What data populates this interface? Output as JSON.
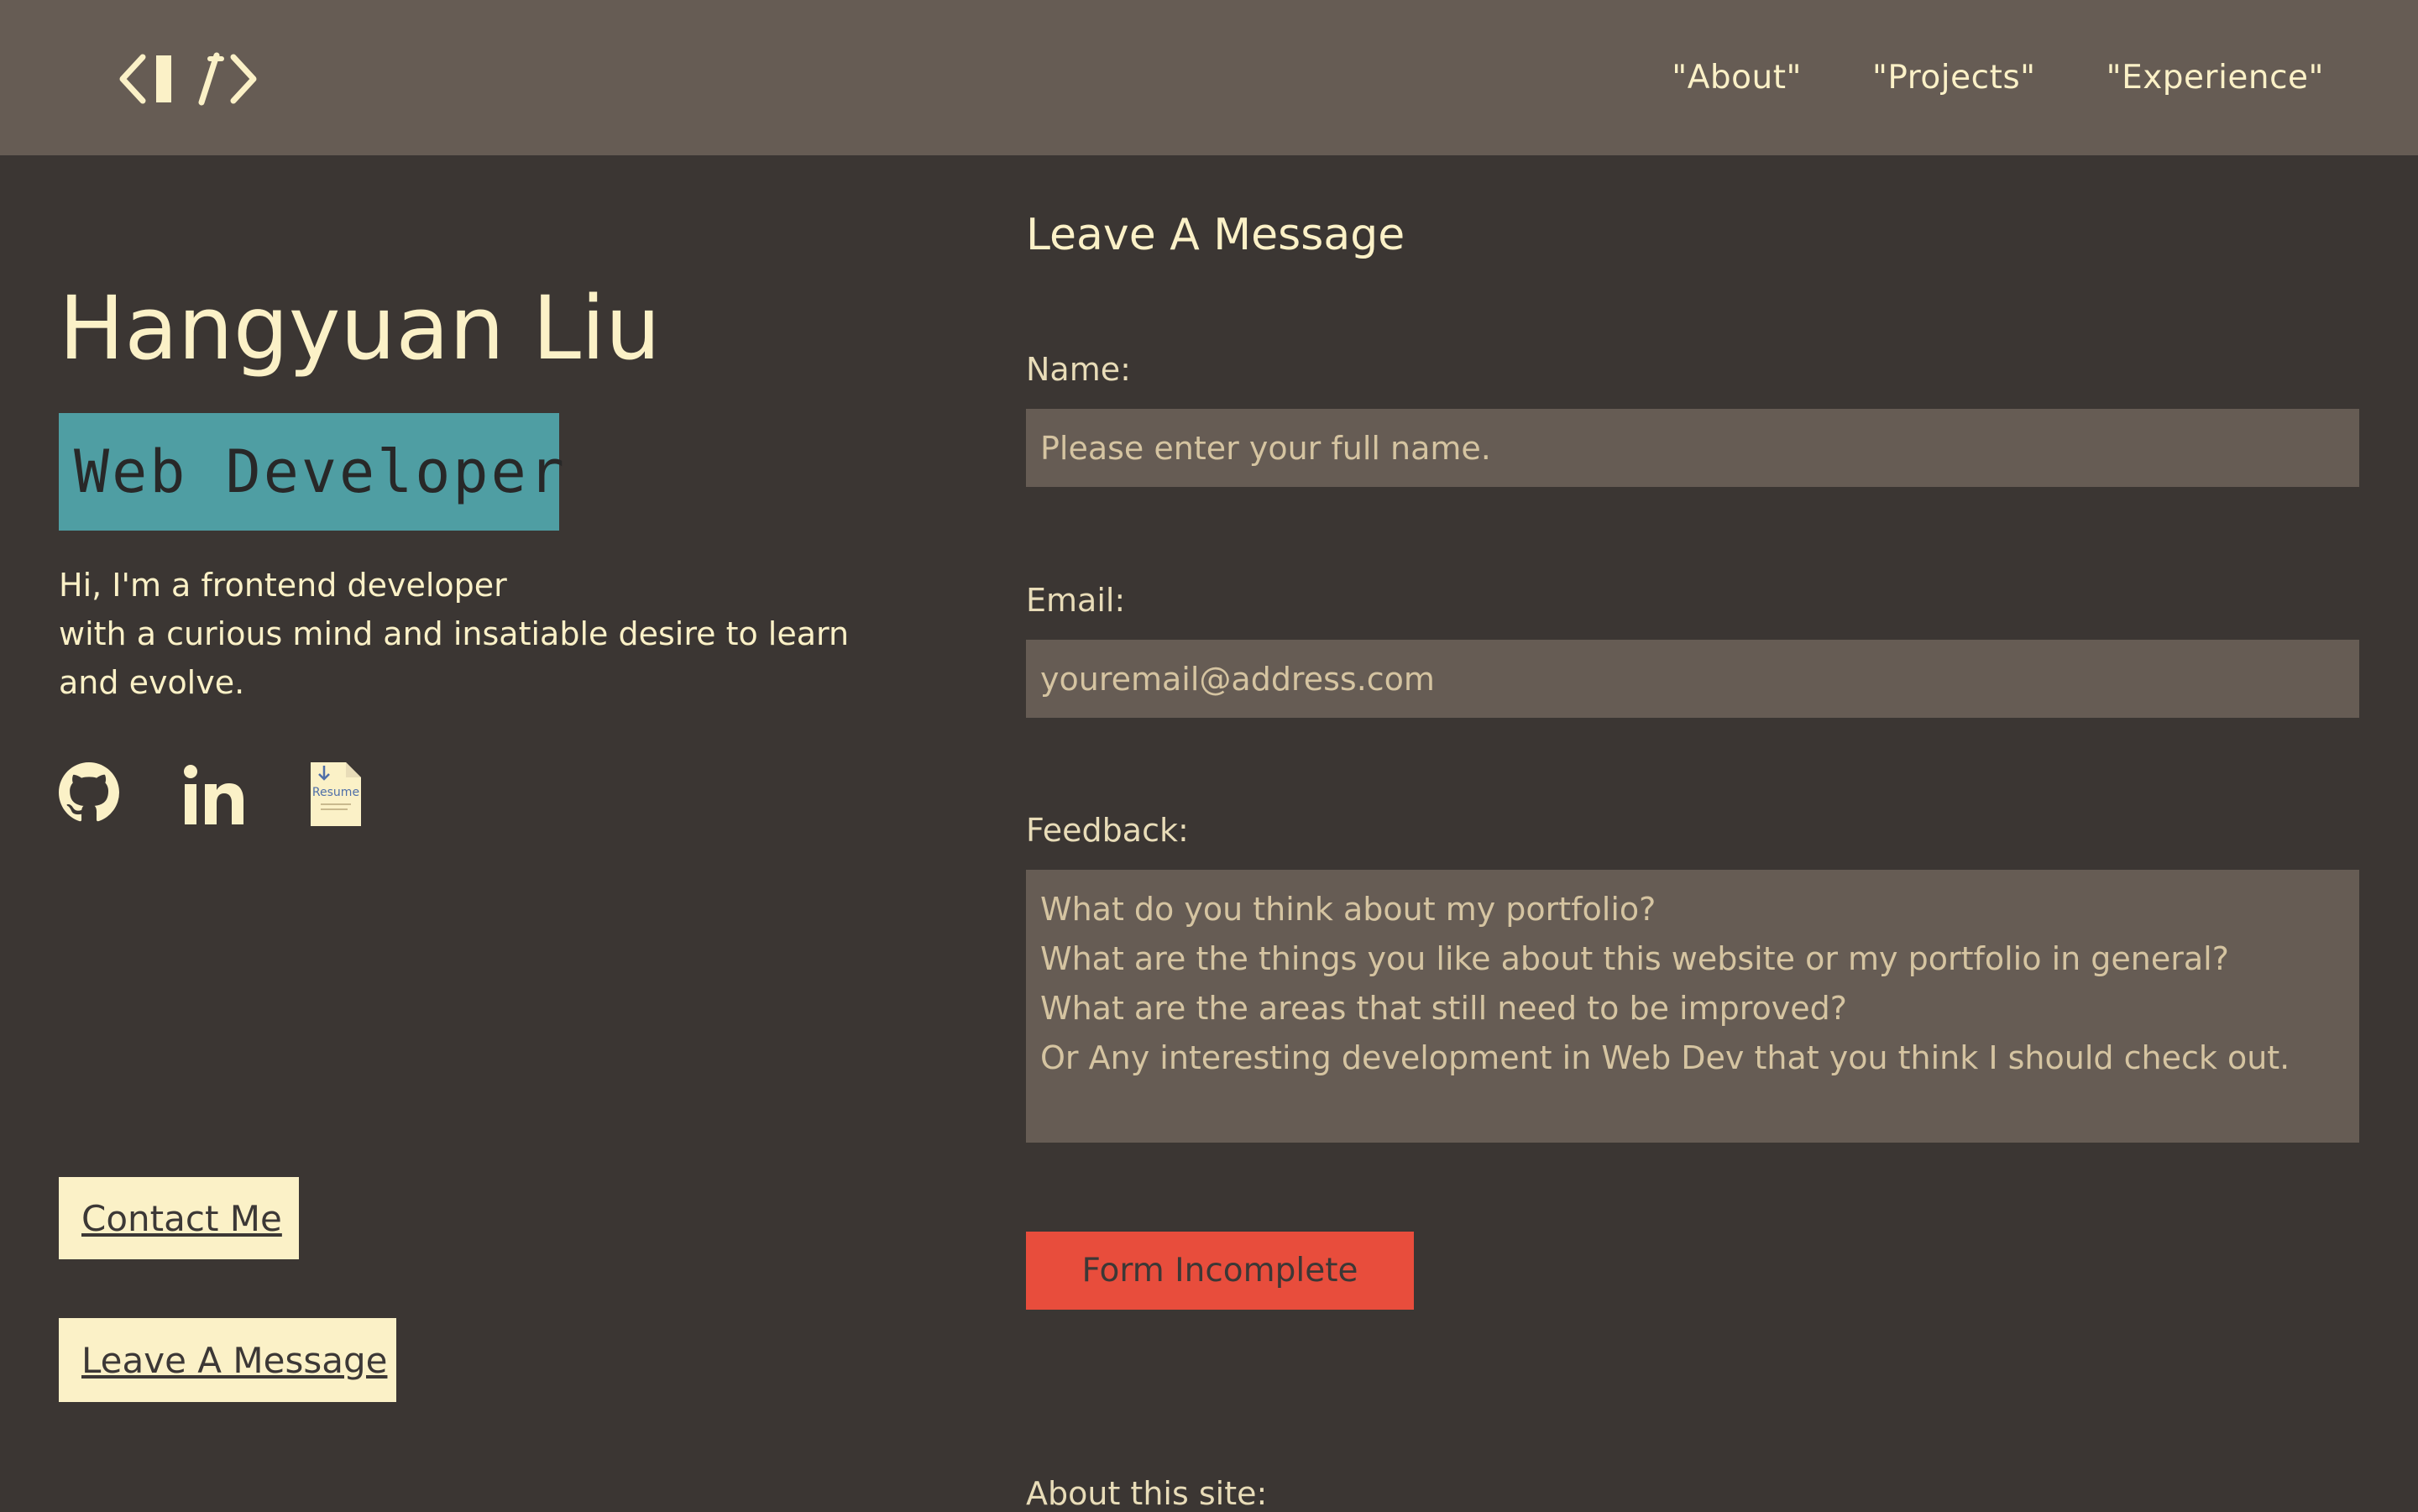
{
  "header": {
    "logo_alt": "</>",
    "nav": [
      {
        "label": "\"About\""
      },
      {
        "label": "\"Projects\""
      },
      {
        "label": "\"Experience\""
      }
    ]
  },
  "hero": {
    "name": "Hangyuan Liu",
    "role": "Web Developer",
    "intro_lines": [
      "Hi, I'm a frontend developer",
      "with a curious mind and insatiable desire to learn",
      "and evolve."
    ]
  },
  "socials": {
    "items": [
      {
        "icon": "github-icon"
      },
      {
        "icon": "linkedin-icon"
      },
      {
        "icon": "resume-icon",
        "label": "Resume"
      }
    ]
  },
  "buttons": {
    "contact_label": "Contact Me",
    "leave_message_label": "Leave A Message"
  },
  "form": {
    "title": "Leave A Message",
    "name_label": "Name:",
    "name_placeholder": "Please enter your full name.",
    "email_label": "Email:",
    "email_placeholder": "youremail@address.com",
    "feedback_label": "Feedback:",
    "feedback_placeholder": "What do you think about my portfolio?\nWhat are the things you like about this website or my portfolio in general?\nWhat are the areas that still need to be improved?\nOr Any interesting development in Web Dev that you think I should check out.",
    "submit_label": "Form Incomplete"
  },
  "footer": {
    "about_label": "About this site:"
  },
  "colors": {
    "background": "#3b3633",
    "header": "#665c54",
    "cream": "#fbf1c7",
    "teal": "#4f9ea3",
    "submit_red": "#e84d3c"
  }
}
